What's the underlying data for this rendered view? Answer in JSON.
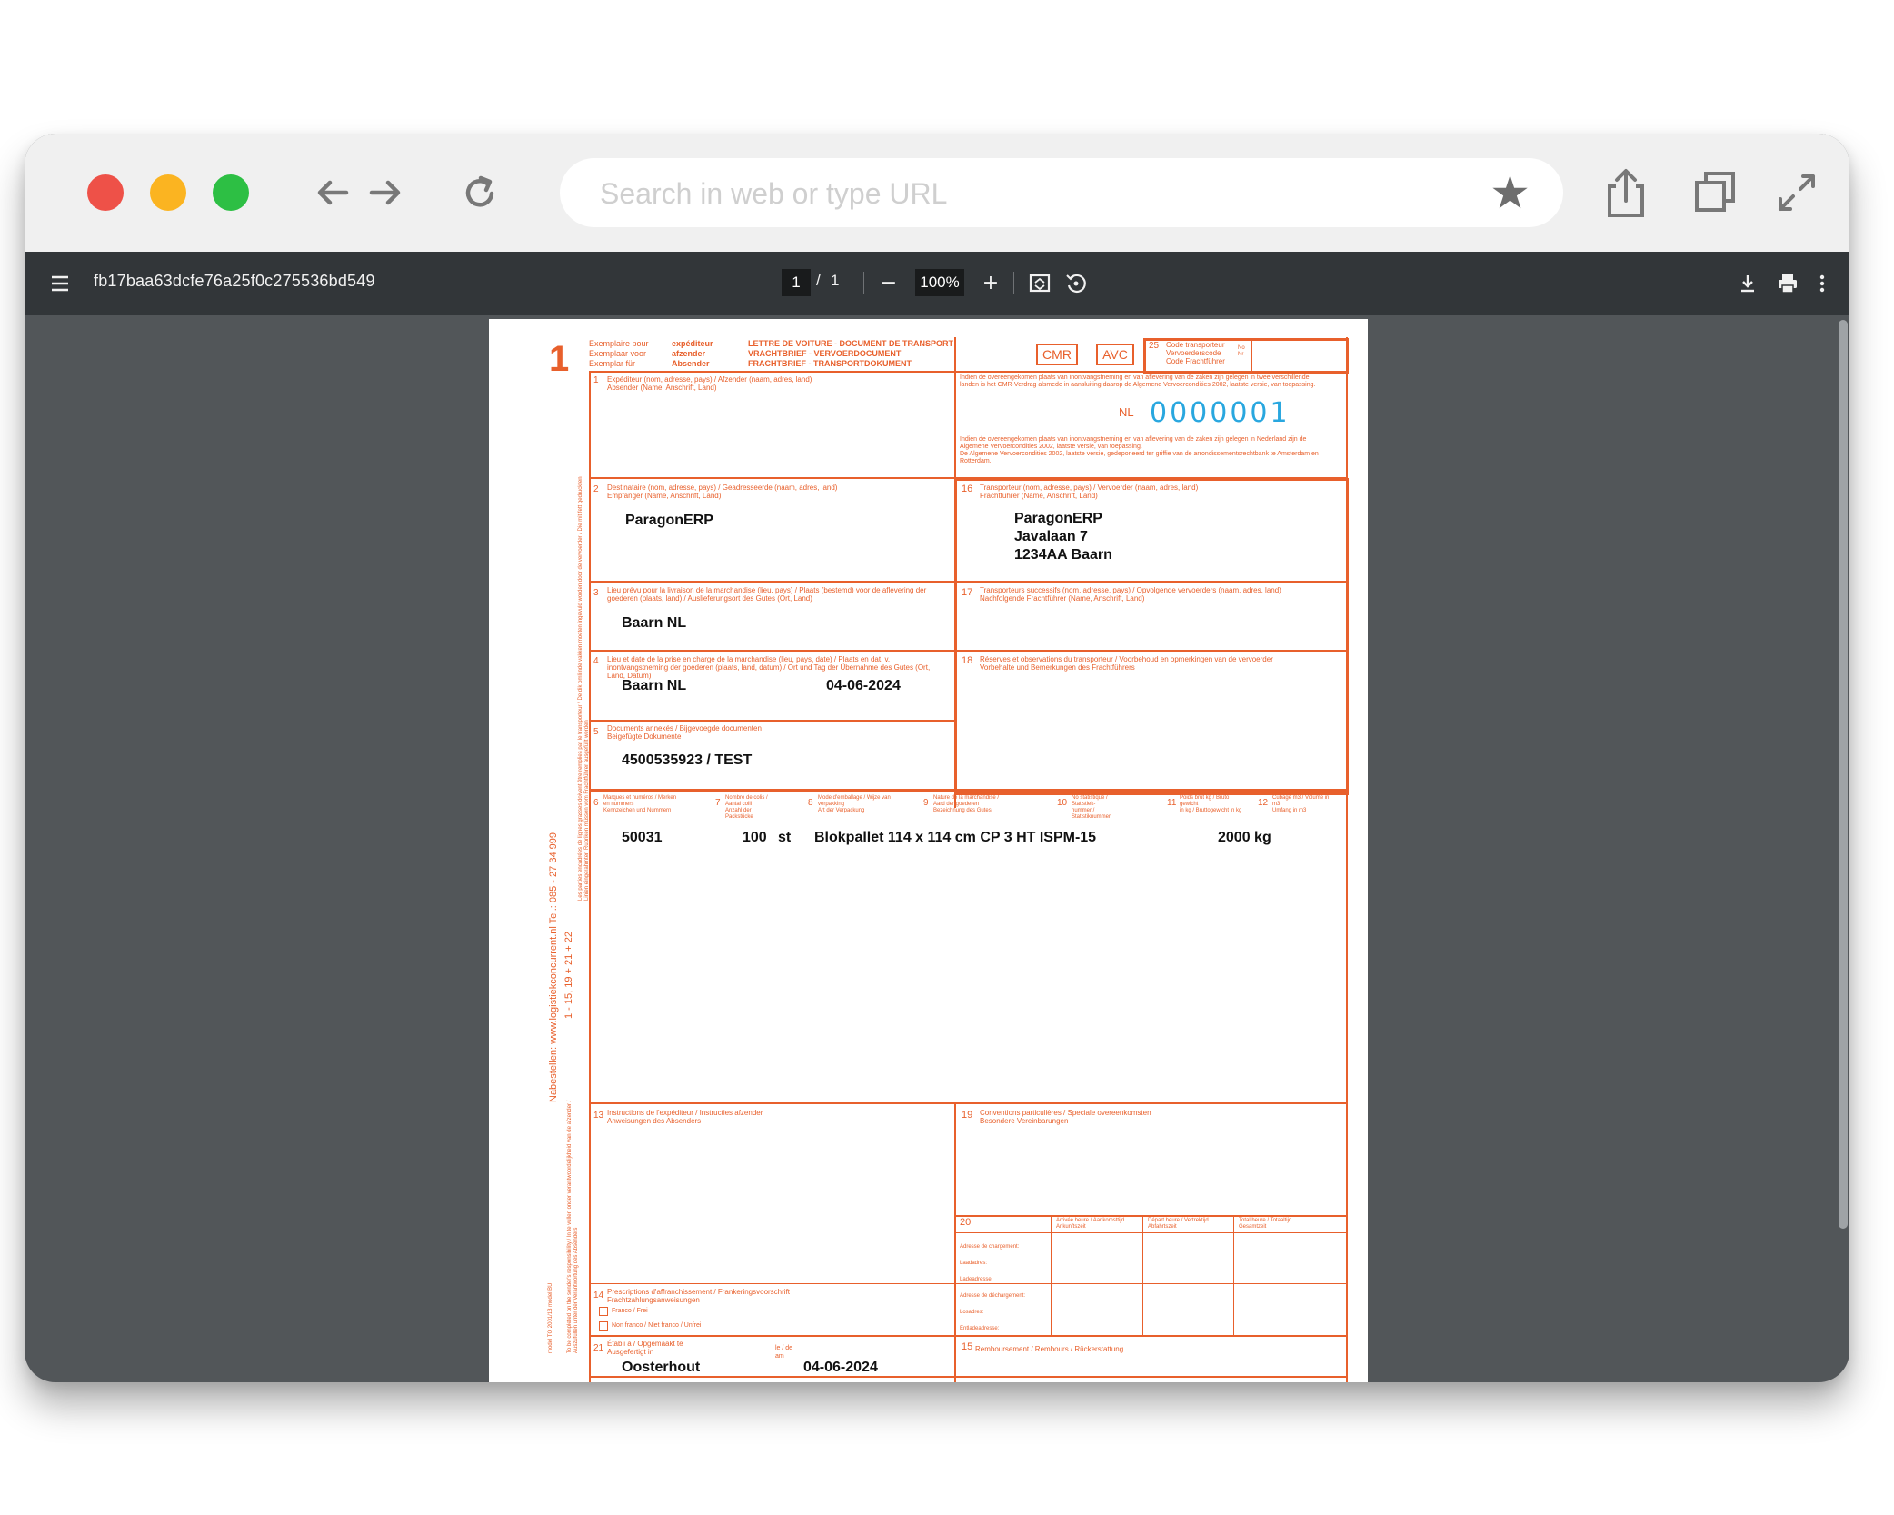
{
  "browser": {
    "url_placeholder": "Search in web or type URL",
    "icons": [
      "back-arrow-icon",
      "forward-arrow-icon",
      "reload-icon",
      "bookmark-star-icon",
      "share-icon",
      "tabs-icon",
      "fullscreen-icon"
    ]
  },
  "viewer": {
    "filename": "fb17baa63dcfe76a25f0c275536bd549",
    "current_page": "1",
    "page_separator": "/",
    "total_pages": "1",
    "zoom": "100%",
    "zoom_out": "−",
    "zoom_in": "+"
  },
  "document": {
    "copy_number": "1",
    "header": {
      "copy_labels": "Exemplaire pour\nExemplaar voor\nExemplar für",
      "copy_for": "expéditeur\nafzender\nAbsender",
      "doc_title": "LETTRE DE VOITURE - DOCUMENT DE TRANSPORT\nVRACHTBRIEF - VERVOERDOCUMENT\nFRACHTBRIEF - TRANSPORTDOKUMENT",
      "badge_cmr": "CMR",
      "badge_avc": "AVC",
      "box25_num": "25",
      "box25_label": "Code transporteur\nVervoerderscode\nCode Frachtführer",
      "box25_no": "No\nNr",
      "legal_top": "Indien de overeengekomen plaats van inontvangstneming en van aflevering van de zaken zijn gelegen in twee verschillende landen is het CMR-Verdrag alsmede in aansluiting daarop de Algemene Vervoercondities 2002, laatste versie, van toepassing.",
      "legal_bottom": "Indien de overeengekomen plaats van inontvangstneming en van aflevering van de zaken zijn gelegen in Nederland zijn de Algemene Vervoercondities 2002, laatste versie, van toepassing.\nDe Algemene Vervoercondities 2002, laatste versie, gedeponeerd ter griffie van de arrondissementsrechtbank te Amsterdam en Rotterdam.",
      "country_prefix": "NL",
      "doc_number": "0000001"
    },
    "fields": {
      "f1_num": "1",
      "f1_label": "Expéditeur (nom, adresse, pays) / Afzender (naam, adres, land)\nAbsender (Name, Anschrift, Land)",
      "f2_num": "2",
      "f2_label": "Destinataire (nom, adresse, pays) / Geadresseerde (naam, adres, land)\nEmpfänger (Name, Anschrift, Land)",
      "f2_value": "ParagonERP",
      "f16_num": "16",
      "f16_label": "Transporteur (nom, adresse, pays) / Vervoerder (naam, adres, land)\nFrachtführer (Name, Anschrift, Land)",
      "f16_line1": "ParagonERP",
      "f16_line2": "Javalaan 7",
      "f16_line3": "1234AA Baarn",
      "f3_num": "3",
      "f3_label": "Lieu prévu pour la livraison de la marchandise (lieu, pays) / Plaats (bestemd) voor de aflevering der goederen (plaats, land) / Auslieferungsort des Gutes (Ort, Land)",
      "f3_value": "Baarn NL",
      "f17_num": "17",
      "f17_label": "Transporteurs successifs (nom, adresse, pays) / Opvolgende vervoerders (naam, adres, land)\nNachfolgende Frachtführer (Name, Anschrift, Land)",
      "f4_num": "4",
      "f4_label": "Lieu et date de la prise en charge de la marchandise (lieu, pays, date) / Plaats en dat. v. inontvangstneming der goederen (plaats, land, datum) / Ort und Tag der Übernahme des Gutes (Ort, Land, Datum)",
      "f4_place": "Baarn NL",
      "f4_date": "04-06-2024",
      "f18_num": "18",
      "f18_label": "Réserves et observations du transporteur / Voorbehoud en opmerkingen van de vervoerder\nVorbehalte und Bemerkungen des Frachtführers",
      "f5_num": "5",
      "f5_label": "Documents annexés / Bijgevoegde documenten\nBeigefügte Dokumente",
      "f5_value": "4500535923 / TEST"
    },
    "goods_headers": [
      {
        "num": "6",
        "label": "Marques et numéros / Merken en nummers\nKennzeichen und Nummern"
      },
      {
        "num": "7",
        "label": "Nombre de colis / Aantal colli\nAnzahl der Packstücke"
      },
      {
        "num": "8",
        "label": "Mode d'emballage / Wijze van verpakking\nArt der Verpackung"
      },
      {
        "num": "9",
        "label": "Nature de la marchandise / Aard der goederen\nBezeichnung des Gutes"
      },
      {
        "num": "10",
        "label": "No statistique / Statistiek-\nnummer / Statistiknummer"
      },
      {
        "num": "11",
        "label": "Poids brut kg / Bruto gewicht\nin kg / Bruttogewicht in kg"
      },
      {
        "num": "12",
        "label": "Cubage m3 / Volume in m3\nUmfang in m3"
      }
    ],
    "goods_row": {
      "marks": "50031",
      "qty": "100",
      "unit": "st",
      "description": "Blokpallet 114 x 114 cm CP 3 HT ISPM-15",
      "weight": "2000 kg"
    },
    "lower": {
      "f13_num": "13",
      "f13_label": "Instructions de l'expéditeur / Instructies afzender\nAnweisungen des Absenders",
      "f19_num": "19",
      "f19_label": "Conventions particulières / Speciale overeenkomsten\nBesondere Vereinbarungen",
      "f20_num": "20",
      "f20_col1": "Arrivée heure / Aankomsttijd\nAnkunftszeit",
      "f20_col2": "Départ heure / Vertrektijd\nAbfahrtszeit",
      "f20_col3": "Total heure / Totaaltijd\nGesamtzeit",
      "f20_load": "Adresse de chargement:\nLaadadres:\nLadeadresse:",
      "f20_unload": "Adresse de déchargement:\nLosadres:\nEntladeadresse:",
      "f14_num": "14",
      "f14_label": "Prescriptions d'affranchissement / Frankeringsvoorschrift\nFrachtzahlungsanweisungen",
      "f14_opt1": "Franco / Frei",
      "f14_opt2": "Non franco / Niet franco / Unfrei",
      "f21_num": "21",
      "f21_label": "Établi à / Opgemaakt te\nAusgefertigt in",
      "f21_place": "Oosterhout",
      "f21_date_label": "le / de\nam",
      "f21_date": "04-06-2024",
      "f15_num": "15",
      "f15_label": "Remboursement / Rembours / Rückerstattung"
    },
    "side_text": {
      "order": "Nabestellen: www.logistiekconcurrent.nl   Tel.: 085 - 27 34 999",
      "boxes": "1 - 15, 19 + 21 + 22",
      "model": "model TO 2001/13  model BU",
      "liability": "Les parties encadrées de lignes grasses doivent être remplies par le transporteur / De dik omlijnde vakken moeten ingevuld worden door de vervoerder / Die mit fett gedruckten Linien eingerahmten Rubriken müssen vom Frachtführer ausgefüllt werden",
      "resp": "To be completed on the sender's responsibility / In te vullen onder verantwoordelijkheid van de afzender / Auszufüllen unter der Verantwortung des Absenders"
    }
  }
}
